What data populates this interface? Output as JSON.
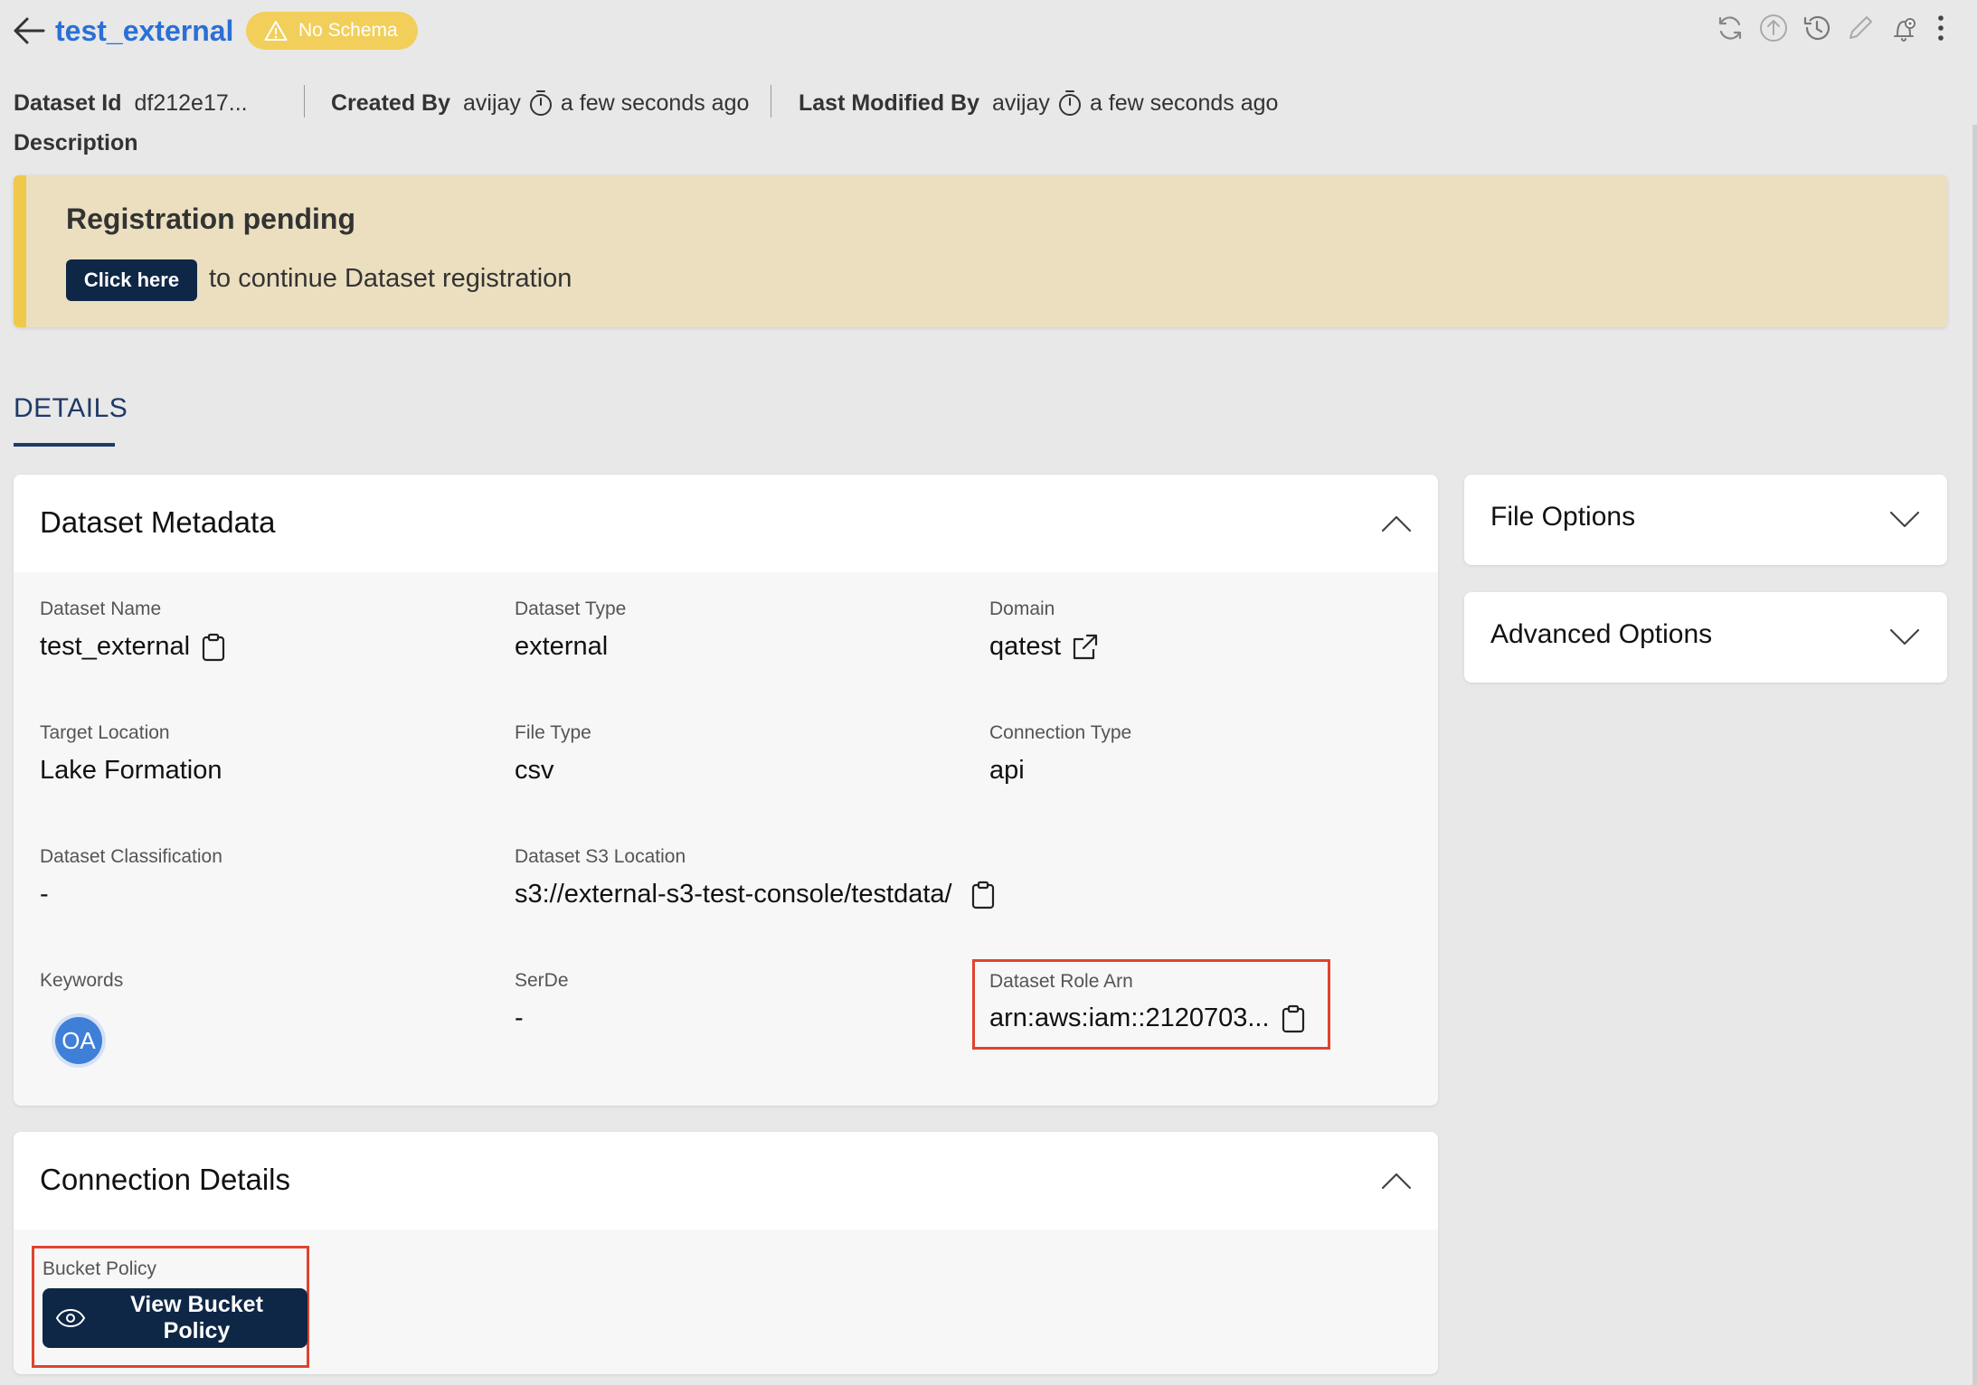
{
  "header": {
    "title": "test_external",
    "badge": "No Schema",
    "icons": [
      "refresh-icon",
      "upload-icon",
      "history-icon",
      "edit-icon",
      "settings-icon",
      "more-icon"
    ]
  },
  "meta": {
    "dataset_id_label": "Dataset Id",
    "dataset_id": "df212e17...",
    "created_by_label": "Created By",
    "created_by": "avijay",
    "created_time": "a few seconds ago",
    "modified_by_label": "Last Modified By",
    "modified_by": "avijay",
    "modified_time": "a few seconds ago",
    "description_label": "Description"
  },
  "banner": {
    "title": "Registration pending",
    "button": "Click here",
    "text": "to continue Dataset registration"
  },
  "tabs": {
    "details": "DETAILS"
  },
  "metadata": {
    "title": "Dataset Metadata",
    "fields": {
      "name_label": "Dataset Name",
      "name": "test_external",
      "type_label": "Dataset Type",
      "type": "external",
      "domain_label": "Domain",
      "domain": "qatest",
      "target_label": "Target Location",
      "target": "Lake Formation",
      "filetype_label": "File Type",
      "filetype": "csv",
      "conn_label": "Connection Type",
      "conn": "api",
      "class_label": "Dataset Classification",
      "class": "-",
      "s3_label": "Dataset S3 Location",
      "s3": "s3://external-s3-test-console/testdata/",
      "keywords_label": "Keywords",
      "keyword_avatar": "OA",
      "serde_label": "SerDe",
      "serde": "-",
      "role_label": "Dataset Role Arn",
      "role": "arn:aws:iam::2120703..."
    }
  },
  "connection": {
    "title": "Connection Details",
    "bucket_label": "Bucket Policy",
    "view_button": "View Bucket Policy"
  },
  "side": {
    "file_options": "File Options",
    "advanced_options": "Advanced Options"
  },
  "colors": {
    "title_blue": "#2b6fd6",
    "badge_yellow": "#f2cf5a",
    "navy": "#0f2746",
    "banner_bg": "#ebdfc0",
    "highlight_red": "#e0432f"
  }
}
